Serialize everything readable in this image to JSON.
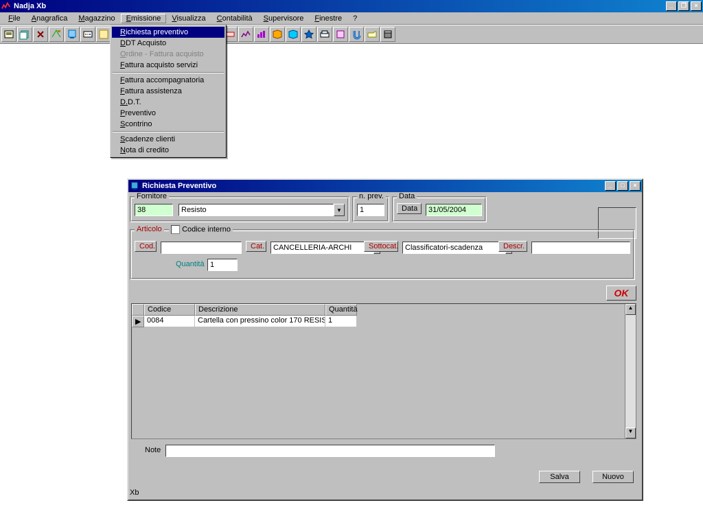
{
  "app": {
    "title": "Nadja Xb"
  },
  "menubar": [
    "File",
    "Anagrafica",
    "Magazzino",
    "Emissione",
    "Visualizza",
    "Contabilità",
    "Supervisore",
    "Finestre",
    "?"
  ],
  "dropdown": {
    "items": [
      {
        "label": "Richiesta preventivo",
        "hl": true
      },
      {
        "label": "DDT Acquisto"
      },
      {
        "label": "Ordine - Fattura acquisto",
        "disabled": true
      },
      {
        "label": "Fattura acquisto servizi"
      },
      {
        "sep": true
      },
      {
        "label": "Fattura accompagnatoria"
      },
      {
        "label": "Fattura assistenza"
      },
      {
        "label": "D.D.T."
      },
      {
        "label": "Preventivo"
      },
      {
        "label": "Scontrino"
      },
      {
        "sep": true
      },
      {
        "label": "Scadenze clienti"
      },
      {
        "label": "Nota di credito"
      }
    ]
  },
  "child": {
    "title": "Richiesta Preventivo",
    "fornitore": {
      "legend": "Fornitore",
      "code": "38",
      "name": "Resisto"
    },
    "nprev": {
      "legend": "n. prev.",
      "value": "1"
    },
    "data": {
      "legend": "Data",
      "btn": "Data",
      "value": "31/05/2004"
    },
    "articolo": {
      "legend": "Articolo",
      "codint_label": "Codice interno",
      "cod_label": "Cod.",
      "cod_value": "",
      "cat_label": "Cat.",
      "cat_value": "CANCELLERIA-ARCHI",
      "sotto_label": "Sottocat.",
      "sotto_value": "Classificatori-scadenza",
      "descr_label": "Descr.",
      "descr_value": "",
      "qta_label": "Quantità",
      "qta_value": "1"
    },
    "ok": "OK",
    "grid": {
      "headers": [
        "Codice",
        "Descrizione",
        "Quantità"
      ],
      "rows": [
        {
          "codice": "0084",
          "descrizione": "Cartella con pressino color 170 RESIS",
          "quantita": "1"
        }
      ]
    },
    "note_label": "Note",
    "note_value": "",
    "buttons": {
      "salva": "Salva",
      "nuovo": "Nuovo"
    },
    "status": "Xb"
  }
}
